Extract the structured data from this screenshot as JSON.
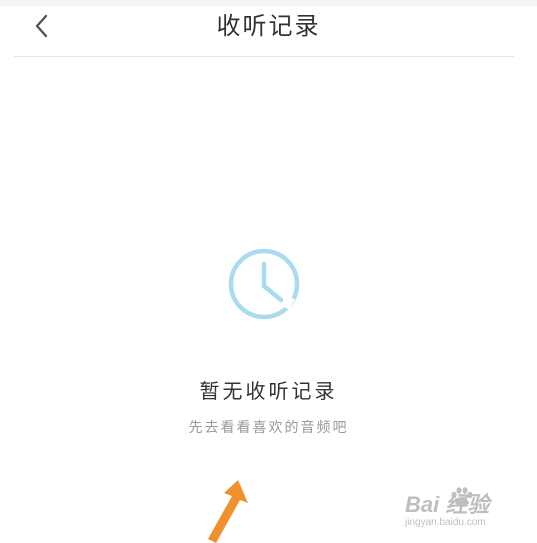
{
  "header": {
    "title": "收听记录",
    "back_icon": "chevron-left-icon"
  },
  "empty_state": {
    "icon": "clock-icon",
    "title": "暂无收听记录",
    "subtitle": "先去看看喜欢的音频吧"
  },
  "watermark": {
    "brand": "Bai  经验",
    "url": "jingyan.baidu.com"
  },
  "colors": {
    "clock_icon": "#a8daf0",
    "arrow": "#f0902e",
    "title_text": "#333333",
    "subtitle_text": "#9a9a9a"
  }
}
